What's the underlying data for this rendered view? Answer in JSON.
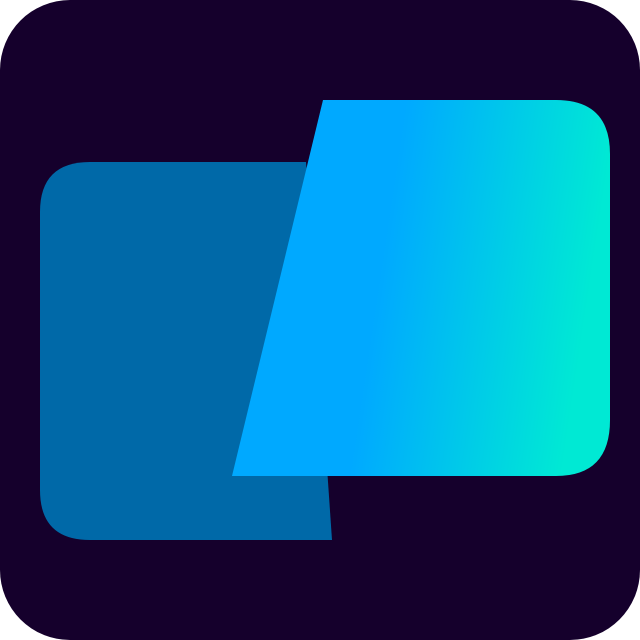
{
  "icon": {
    "name": "app-logo-icon",
    "colors": {
      "background": "#15002c",
      "back_panel": "#0069a8",
      "front_panel_start": "#00a9ff",
      "front_panel_end": "#00e9d4"
    }
  }
}
